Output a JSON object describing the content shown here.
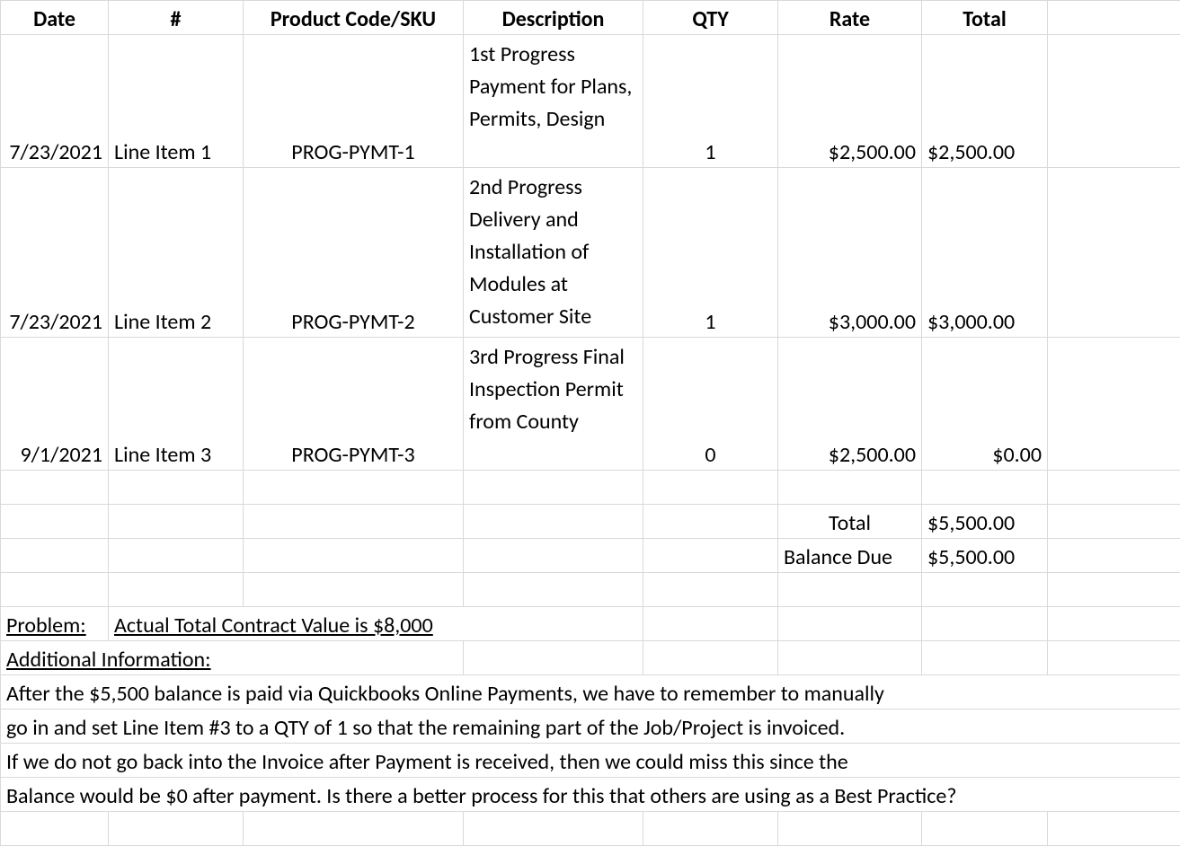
{
  "headers": {
    "date": "Date",
    "num": "#",
    "sku": "Product Code/SKU",
    "desc": "Description",
    "qty": "QTY",
    "rate": "Rate",
    "total": "Total"
  },
  "rows": [
    {
      "date": "7/23/2021",
      "num": "Line Item 1",
      "sku": "PROG-PYMT-1",
      "desc": "1st Progress Payment for Plans, Permits, Design",
      "qty": "1",
      "rate": "$2,500.00",
      "total": "$2,500.00"
    },
    {
      "date": "7/23/2021",
      "num": "Line Item 2",
      "sku": "PROG-PYMT-2",
      "desc": "2nd Progress Delivery and Installation of Modules at Customer Site",
      "qty": "1",
      "rate": "$3,000.00",
      "total": "$3,000.00"
    },
    {
      "date": "9/1/2021",
      "num": "Line Item 3",
      "sku": "PROG-PYMT-3",
      "desc": "3rd Progress Final Inspection Permit from County",
      "qty": "0",
      "rate": "$2,500.00",
      "total": "$0.00"
    }
  ],
  "summary": {
    "total_label": "Total",
    "total_value": "$5,500.00",
    "balance_label": "Balance Due",
    "balance_value": "$5,500.00"
  },
  "notes": {
    "problem_label": "Problem:",
    "problem_text": "Actual Total Contract Value is $8,000",
    "additional_label": "Additional Information:",
    "line1": "After the $5,500 balance is paid via Quickbooks Online Payments, we have to remember to manually",
    "line2": "go in and set Line Item #3 to a QTY of 1 so that the remaining part of the Job/Project is invoiced.",
    "line3": "If we do not go back into the Invoice after Payment is received, then we could miss this since the",
    "line4": "Balance would be $0 after payment.  Is there a better process for this that others are using as a Best Practice?"
  }
}
